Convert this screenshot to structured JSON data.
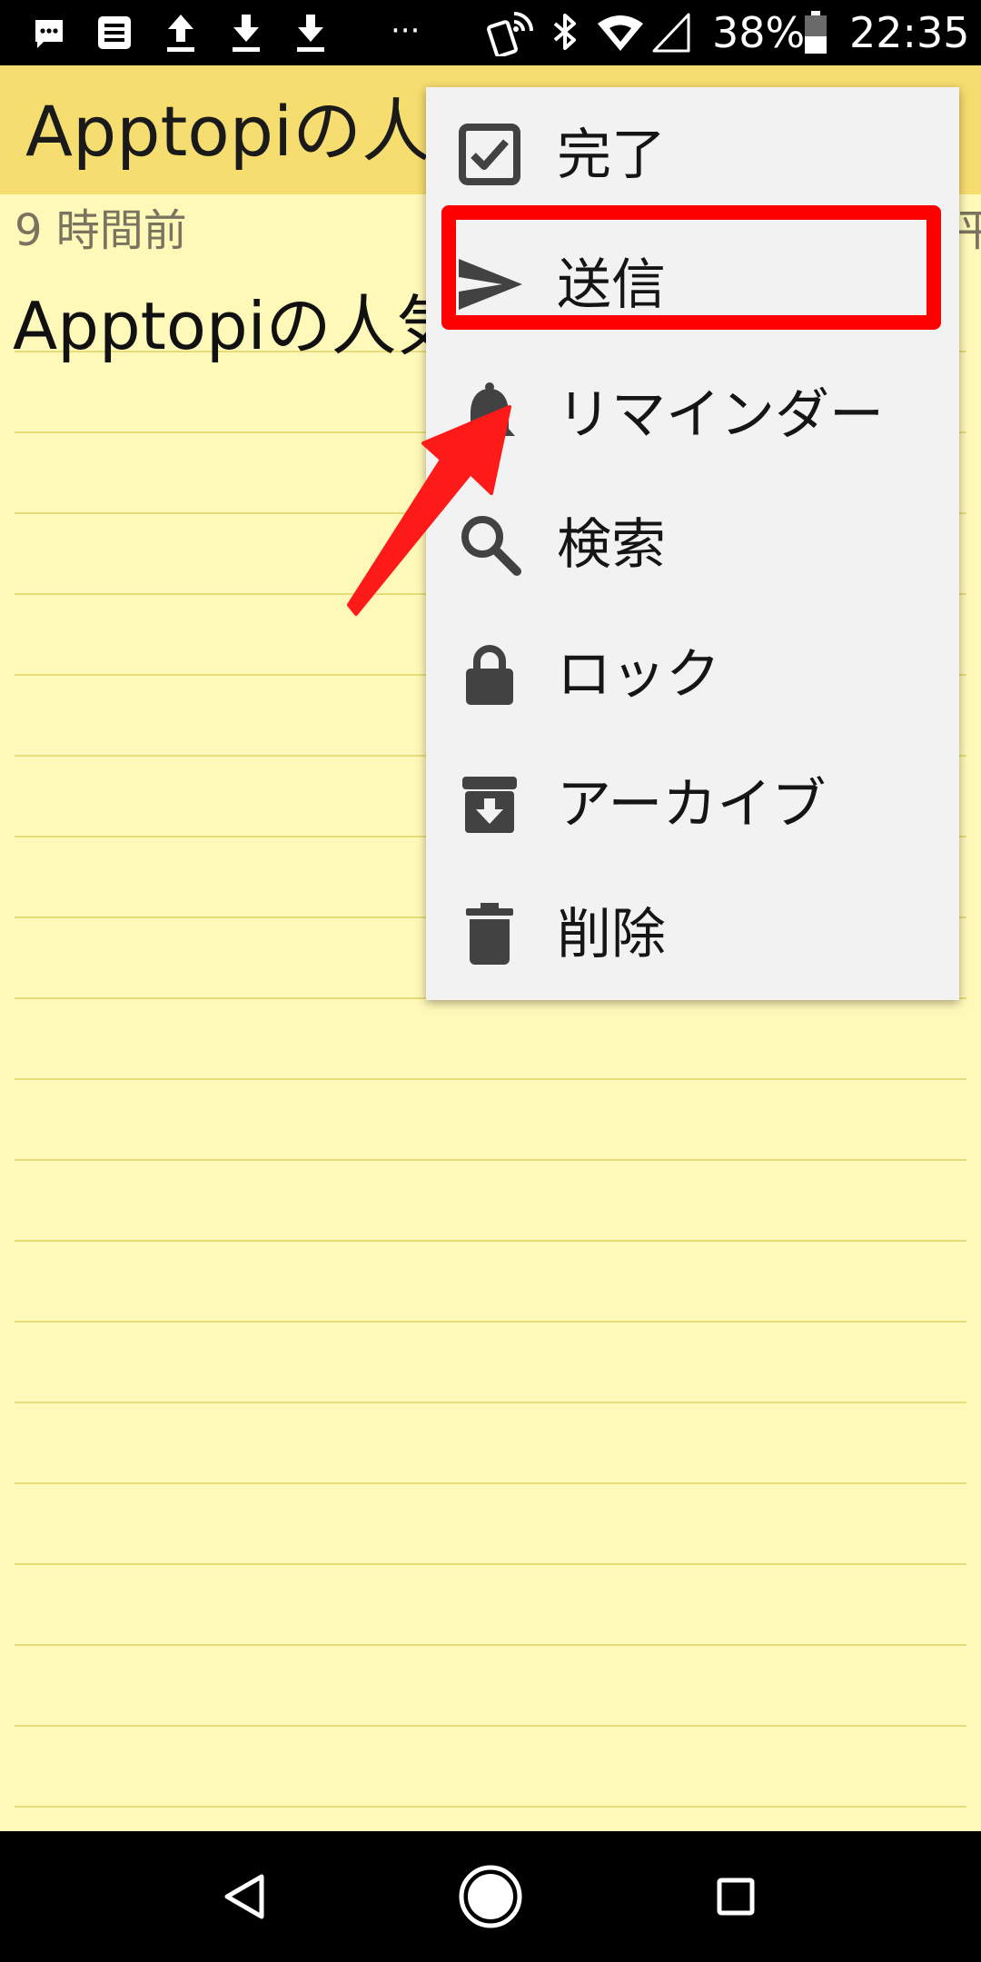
{
  "status_bar": {
    "icons": [
      "message-icon",
      "notes-icon",
      "upload-icon",
      "download-icon",
      "download-icon",
      "more-dots-icon",
      "nfc-icon",
      "bluetooth-icon",
      "wifi-icon",
      "signal-icon",
      "battery-icon"
    ],
    "more_dots": "···",
    "battery_percent": "38%",
    "time": "22:35"
  },
  "app_bar": {
    "title": "Apptopiの人気"
  },
  "note": {
    "timestamp": "9 時間前",
    "date_fragment": "平",
    "body": "Apptopiの人気"
  },
  "menu": {
    "items": [
      {
        "label": "完了",
        "icon": "checkbox-icon"
      },
      {
        "label": "送信",
        "icon": "send-icon"
      },
      {
        "label": "リマインダー",
        "icon": "bell-icon"
      },
      {
        "label": "検索",
        "icon": "search-icon"
      },
      {
        "label": "ロック",
        "icon": "lock-icon"
      },
      {
        "label": "アーカイブ",
        "icon": "archive-icon"
      },
      {
        "label": "削除",
        "icon": "trash-icon"
      }
    ],
    "highlighted": "送信"
  },
  "nav_bar": {
    "buttons": [
      "back-icon",
      "home-icon",
      "recents-icon"
    ]
  },
  "colors": {
    "app_bar": "#f6dd6f",
    "note_background": "#fef8b9",
    "ruled_line": "#e8dc7a",
    "menu_background": "#f2f2f2",
    "menu_icon": "#424242",
    "annotation_red": "#ff0000"
  }
}
